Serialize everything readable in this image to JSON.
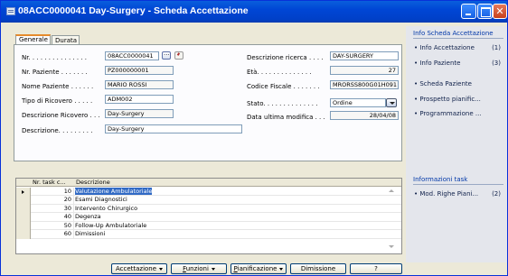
{
  "window": {
    "title": "08ACC0000041 Day-Surgery - Scheda Accettazione",
    "controls": {
      "minimize": "",
      "maximize": "",
      "close": "✕"
    }
  },
  "tabs": [
    {
      "label": "Generale",
      "active": true
    },
    {
      "label": "Durata",
      "active": false
    }
  ],
  "form": {
    "nr_label": "Nr. . . . . . . . . . . . . . .",
    "nr_value": "08ACC0000041",
    "nr_paziente_label": "Nr. Paziente . . . . . . .",
    "nr_paziente_value": "PZ000000001",
    "nome_paziente_label": "Nome Paziente . . . . . .",
    "nome_paziente_value": "MARIO ROSSI",
    "tipo_ricovero_label": "Tipo di Ricovero . . . . .",
    "tipo_ricovero_value": "ADM002",
    "descrizione_ricovero_label": "Descrizione Ricovero . . .",
    "descrizione_ricovero_value": "Day-Surgery",
    "descrizione_label": "Descrizione. . . . . . . . .",
    "descrizione_value": "Day-Surgery",
    "descrizione_ricerca_label": "Descrizione ricerca . . . .",
    "descrizione_ricerca_value": "DAY-SURGERY",
    "eta_label": "Età. . . . . . . . . . . . . .",
    "eta_value": "27",
    "codice_fiscale_label": "Codice Fiscale . . . . . . .",
    "codice_fiscale_value": "MRORSS800G01H091",
    "stato_label": "Stato. . . . . . . . . . . . . .",
    "stato_value": "Ordine",
    "data_modifica_label": "Data ultima modifica . . .",
    "data_modifica_value": "28/04/08"
  },
  "info_scheda": {
    "title": "Info Scheda Accettazione",
    "items": [
      {
        "label": "• Info Accettazione",
        "count": "(1)"
      },
      {
        "label": "• Info Paziente",
        "count": "(3)"
      },
      {
        "label": "• Scheda Paziente",
        "count": ""
      },
      {
        "label": "• Prospetto pianific...",
        "count": ""
      },
      {
        "label": "• Programmazione ...",
        "count": ""
      }
    ]
  },
  "info_task": {
    "title": "Informazioni task",
    "items": [
      {
        "label": "• Mod. Righe Piani...",
        "count": "(2)"
      }
    ]
  },
  "grid": {
    "headers": {
      "nr": "Nr. task c...",
      "desc": "Descrizione"
    },
    "rows": [
      {
        "nr": "10",
        "desc": "Valutazione Ambulatoriale",
        "selected": true
      },
      {
        "nr": "20",
        "desc": "Esami Diagnostici"
      },
      {
        "nr": "30",
        "desc": "Intervento Chirurgico"
      },
      {
        "nr": "40",
        "desc": "Degenza"
      },
      {
        "nr": "50",
        "desc": "Follow-Up Ambulatoriale"
      },
      {
        "nr": "60",
        "desc": "Dimissioni"
      }
    ]
  },
  "buttons": {
    "accettazione": "Accettazione",
    "funzioni_u": "F",
    "funzioni_rest": "unzioni",
    "pianificazione_u": "P",
    "pianificazione_rest": "ianificazione",
    "dimissione": "Dimissione",
    "help": "?"
  },
  "colors": {
    "titlebar": "#0046d5",
    "selection": "#316ac5",
    "tab_accent": "#e68b2c",
    "info_title": "#0037a8"
  }
}
